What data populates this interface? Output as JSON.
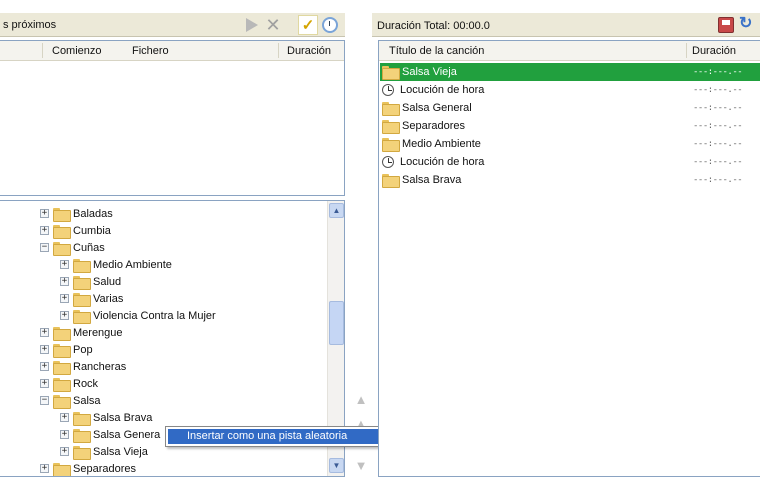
{
  "left_panel": {
    "title": "s próximos",
    "toolbar": {
      "play_icon": "play-icon",
      "stop_icon": "close-x-icon",
      "check_icon": "checkmark-icon",
      "clock_icon": "clock-icon"
    },
    "queue_columns": [
      "Comienzo",
      "Fichero",
      "Duración"
    ]
  },
  "tree": {
    "items": [
      {
        "label": "Baladas",
        "expander": "+",
        "level": 0
      },
      {
        "label": "Cumbia",
        "expander": "+",
        "level": 0
      },
      {
        "label": "Cuñas",
        "expander": "−",
        "level": 0
      },
      {
        "label": "Medio Ambiente",
        "expander": "+",
        "level": 1
      },
      {
        "label": "Salud",
        "expander": "+",
        "level": 1
      },
      {
        "label": "Varias",
        "expander": "+",
        "level": 1
      },
      {
        "label": "Violencia Contra la Mujer",
        "expander": "+",
        "level": 1
      },
      {
        "label": "Merengue",
        "expander": "+",
        "level": 0
      },
      {
        "label": "Pop",
        "expander": "+",
        "level": 0
      },
      {
        "label": "Rancheras",
        "expander": "+",
        "level": 0
      },
      {
        "label": "Rock",
        "expander": "+",
        "level": 0
      },
      {
        "label": "Salsa",
        "expander": "−",
        "level": 0
      },
      {
        "label": "Salsa Brava",
        "expander": "+",
        "level": 1
      },
      {
        "label": "Salsa Genera",
        "expander": "+",
        "level": 1
      },
      {
        "label": "Salsa Vieja",
        "expander": "+",
        "level": 1
      },
      {
        "label": "Separadores",
        "expander": "+",
        "level": 0
      }
    ]
  },
  "context_menu": {
    "item": "Insertar como una pista aleatoria"
  },
  "right_panel": {
    "title": "Duración Total: 00:00.0",
    "columns": [
      "Título de la canción",
      "Duración"
    ],
    "items": [
      {
        "name": "Salsa Vieja",
        "icon": "folder",
        "duration": "---:---.--",
        "selected": true
      },
      {
        "name": "Locución de hora",
        "icon": "clock",
        "duration": "---:---.--",
        "selected": false
      },
      {
        "name": "Salsa General",
        "icon": "folder",
        "duration": "---:---.--",
        "selected": false
      },
      {
        "name": "Separadores",
        "icon": "folder",
        "duration": "---:---.--",
        "selected": false
      },
      {
        "name": "Medio Ambiente",
        "icon": "folder",
        "duration": "---:---.--",
        "selected": false
      },
      {
        "name": "Locución de hora",
        "icon": "clock",
        "duration": "---:---.--",
        "selected": false
      },
      {
        "name": "Salsa Brava",
        "icon": "folder",
        "duration": "---:---.--",
        "selected": false
      }
    ]
  },
  "colors": {
    "selection_green": "#21a03e",
    "menu_highlight": "#316ac5",
    "header_bg": "#ece9d8"
  }
}
